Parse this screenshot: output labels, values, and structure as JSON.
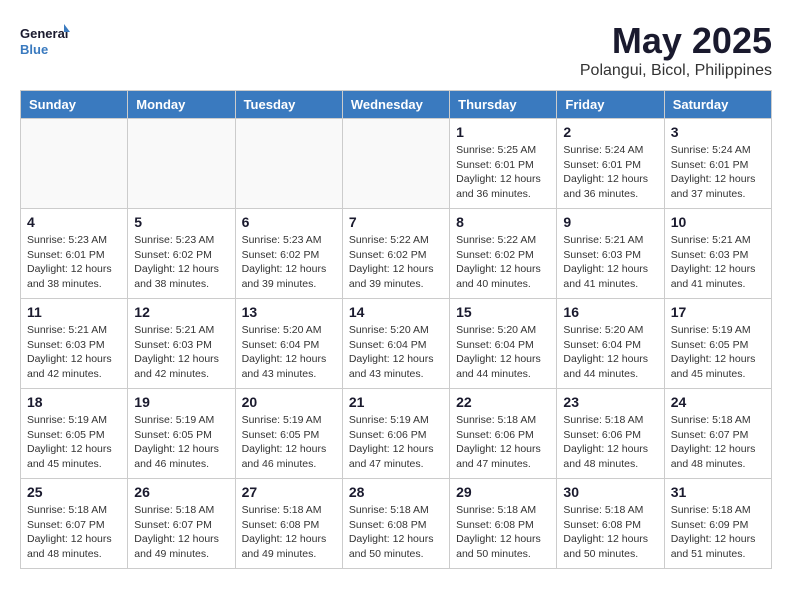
{
  "logo": {
    "line1": "General",
    "line2": "Blue"
  },
  "title": "May 2025",
  "location": "Polangui, Bicol, Philippines",
  "days_of_week": [
    "Sunday",
    "Monday",
    "Tuesday",
    "Wednesday",
    "Thursday",
    "Friday",
    "Saturday"
  ],
  "weeks": [
    [
      {
        "day": "",
        "info": ""
      },
      {
        "day": "",
        "info": ""
      },
      {
        "day": "",
        "info": ""
      },
      {
        "day": "",
        "info": ""
      },
      {
        "day": "1",
        "info": "Sunrise: 5:25 AM\nSunset: 6:01 PM\nDaylight: 12 hours\nand 36 minutes."
      },
      {
        "day": "2",
        "info": "Sunrise: 5:24 AM\nSunset: 6:01 PM\nDaylight: 12 hours\nand 36 minutes."
      },
      {
        "day": "3",
        "info": "Sunrise: 5:24 AM\nSunset: 6:01 PM\nDaylight: 12 hours\nand 37 minutes."
      }
    ],
    [
      {
        "day": "4",
        "info": "Sunrise: 5:23 AM\nSunset: 6:01 PM\nDaylight: 12 hours\nand 38 minutes."
      },
      {
        "day": "5",
        "info": "Sunrise: 5:23 AM\nSunset: 6:02 PM\nDaylight: 12 hours\nand 38 minutes."
      },
      {
        "day": "6",
        "info": "Sunrise: 5:23 AM\nSunset: 6:02 PM\nDaylight: 12 hours\nand 39 minutes."
      },
      {
        "day": "7",
        "info": "Sunrise: 5:22 AM\nSunset: 6:02 PM\nDaylight: 12 hours\nand 39 minutes."
      },
      {
        "day": "8",
        "info": "Sunrise: 5:22 AM\nSunset: 6:02 PM\nDaylight: 12 hours\nand 40 minutes."
      },
      {
        "day": "9",
        "info": "Sunrise: 5:21 AM\nSunset: 6:03 PM\nDaylight: 12 hours\nand 41 minutes."
      },
      {
        "day": "10",
        "info": "Sunrise: 5:21 AM\nSunset: 6:03 PM\nDaylight: 12 hours\nand 41 minutes."
      }
    ],
    [
      {
        "day": "11",
        "info": "Sunrise: 5:21 AM\nSunset: 6:03 PM\nDaylight: 12 hours\nand 42 minutes."
      },
      {
        "day": "12",
        "info": "Sunrise: 5:21 AM\nSunset: 6:03 PM\nDaylight: 12 hours\nand 42 minutes."
      },
      {
        "day": "13",
        "info": "Sunrise: 5:20 AM\nSunset: 6:04 PM\nDaylight: 12 hours\nand 43 minutes."
      },
      {
        "day": "14",
        "info": "Sunrise: 5:20 AM\nSunset: 6:04 PM\nDaylight: 12 hours\nand 43 minutes."
      },
      {
        "day": "15",
        "info": "Sunrise: 5:20 AM\nSunset: 6:04 PM\nDaylight: 12 hours\nand 44 minutes."
      },
      {
        "day": "16",
        "info": "Sunrise: 5:20 AM\nSunset: 6:04 PM\nDaylight: 12 hours\nand 44 minutes."
      },
      {
        "day": "17",
        "info": "Sunrise: 5:19 AM\nSunset: 6:05 PM\nDaylight: 12 hours\nand 45 minutes."
      }
    ],
    [
      {
        "day": "18",
        "info": "Sunrise: 5:19 AM\nSunset: 6:05 PM\nDaylight: 12 hours\nand 45 minutes."
      },
      {
        "day": "19",
        "info": "Sunrise: 5:19 AM\nSunset: 6:05 PM\nDaylight: 12 hours\nand 46 minutes."
      },
      {
        "day": "20",
        "info": "Sunrise: 5:19 AM\nSunset: 6:05 PM\nDaylight: 12 hours\nand 46 minutes."
      },
      {
        "day": "21",
        "info": "Sunrise: 5:19 AM\nSunset: 6:06 PM\nDaylight: 12 hours\nand 47 minutes."
      },
      {
        "day": "22",
        "info": "Sunrise: 5:18 AM\nSunset: 6:06 PM\nDaylight: 12 hours\nand 47 minutes."
      },
      {
        "day": "23",
        "info": "Sunrise: 5:18 AM\nSunset: 6:06 PM\nDaylight: 12 hours\nand 48 minutes."
      },
      {
        "day": "24",
        "info": "Sunrise: 5:18 AM\nSunset: 6:07 PM\nDaylight: 12 hours\nand 48 minutes."
      }
    ],
    [
      {
        "day": "25",
        "info": "Sunrise: 5:18 AM\nSunset: 6:07 PM\nDaylight: 12 hours\nand 48 minutes."
      },
      {
        "day": "26",
        "info": "Sunrise: 5:18 AM\nSunset: 6:07 PM\nDaylight: 12 hours\nand 49 minutes."
      },
      {
        "day": "27",
        "info": "Sunrise: 5:18 AM\nSunset: 6:08 PM\nDaylight: 12 hours\nand 49 minutes."
      },
      {
        "day": "28",
        "info": "Sunrise: 5:18 AM\nSunset: 6:08 PM\nDaylight: 12 hours\nand 50 minutes."
      },
      {
        "day": "29",
        "info": "Sunrise: 5:18 AM\nSunset: 6:08 PM\nDaylight: 12 hours\nand 50 minutes."
      },
      {
        "day": "30",
        "info": "Sunrise: 5:18 AM\nSunset: 6:08 PM\nDaylight: 12 hours\nand 50 minutes."
      },
      {
        "day": "31",
        "info": "Sunrise: 5:18 AM\nSunset: 6:09 PM\nDaylight: 12 hours\nand 51 minutes."
      }
    ]
  ]
}
